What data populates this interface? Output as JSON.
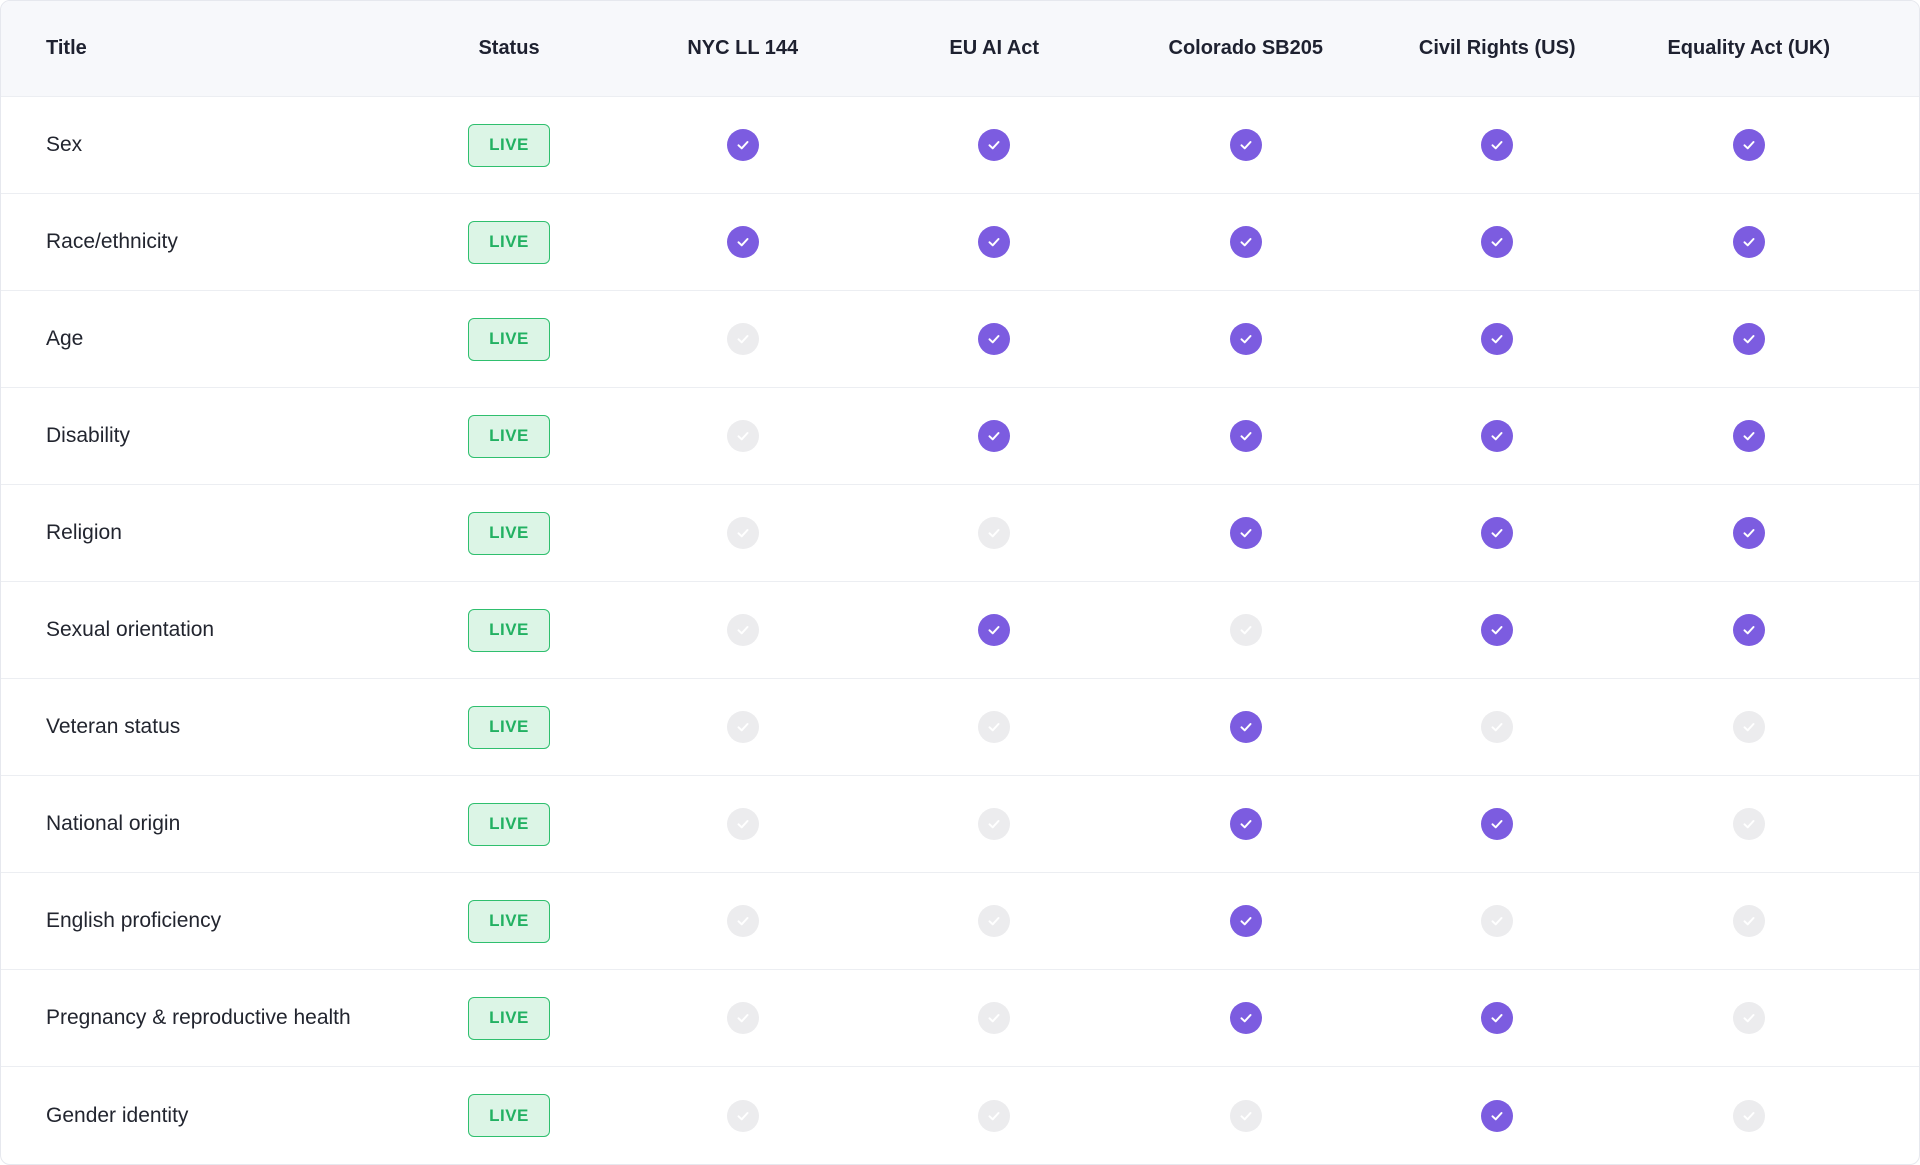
{
  "table": {
    "headers": {
      "title": "Title",
      "status": "Status",
      "laws": [
        "NYC LL 144",
        "EU AI Act",
        "Colorado SB205",
        "Civil Rights (US)",
        "Equality Act (UK)"
      ]
    },
    "rows": [
      {
        "title": "Sex",
        "status": "LIVE",
        "checks": [
          true,
          true,
          true,
          true,
          true
        ]
      },
      {
        "title": "Race/ethnicity",
        "status": "LIVE",
        "checks": [
          true,
          true,
          true,
          true,
          true
        ]
      },
      {
        "title": "Age",
        "status": "LIVE",
        "checks": [
          false,
          true,
          true,
          true,
          true
        ]
      },
      {
        "title": "Disability",
        "status": "LIVE",
        "checks": [
          false,
          true,
          true,
          true,
          true
        ]
      },
      {
        "title": "Religion",
        "status": "LIVE",
        "checks": [
          false,
          false,
          true,
          true,
          true
        ]
      },
      {
        "title": "Sexual orientation",
        "status": "LIVE",
        "checks": [
          false,
          true,
          false,
          true,
          true
        ]
      },
      {
        "title": "Veteran status",
        "status": "LIVE",
        "checks": [
          false,
          false,
          true,
          false,
          false
        ]
      },
      {
        "title": "National origin",
        "status": "LIVE",
        "checks": [
          false,
          false,
          true,
          true,
          false
        ]
      },
      {
        "title": "English proficiency",
        "status": "LIVE",
        "checks": [
          false,
          false,
          true,
          false,
          false
        ]
      },
      {
        "title": "Pregnancy & reproductive health",
        "status": "LIVE",
        "checks": [
          false,
          false,
          true,
          true,
          false
        ]
      },
      {
        "title": "Gender identity",
        "status": "LIVE",
        "checks": [
          false,
          false,
          false,
          true,
          false
        ]
      }
    ]
  },
  "icons": {
    "check_on": "check-circle-icon",
    "check_off": "check-circle-disabled-icon"
  },
  "colors": {
    "check_on": "#7c5ce0",
    "check_off": "#ececee",
    "live_text": "#22b162",
    "live_bg": "#dcf5e6",
    "live_border": "#2fbf6e"
  }
}
